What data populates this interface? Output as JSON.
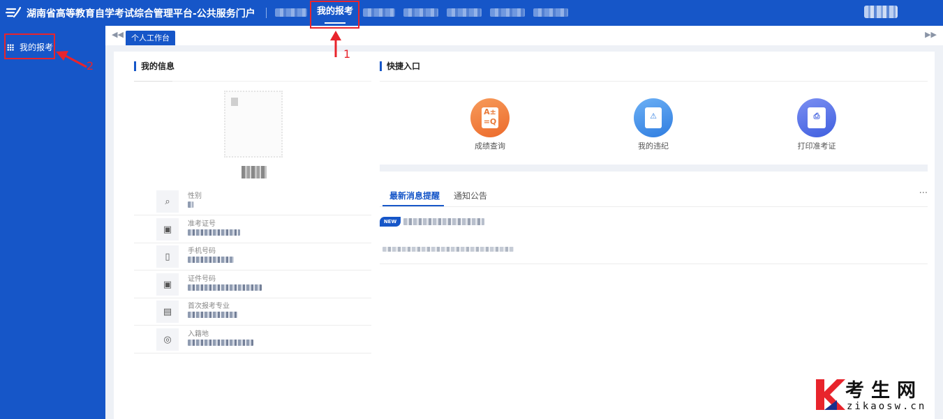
{
  "header": {
    "title": "湖南省高等教育自学考试综合管理平台-公共服务门户",
    "nav_active": "我的报考"
  },
  "sidebar": {
    "items": [
      {
        "label": "我的报考",
        "icon": "grid-icon"
      }
    ]
  },
  "tabs": {
    "items": [
      {
        "label": "个人工作台"
      }
    ]
  },
  "my_info": {
    "title": "我的信息",
    "fields": [
      {
        "label": "性别",
        "icon": "gender-icon"
      },
      {
        "label": "准考证号",
        "icon": "id-card-icon"
      },
      {
        "label": "手机号码",
        "icon": "phone-icon"
      },
      {
        "label": "证件号码",
        "icon": "id-card-icon"
      },
      {
        "label": "首次报考专业",
        "icon": "book-icon"
      },
      {
        "label": "入籍地",
        "icon": "location-icon"
      }
    ]
  },
  "quick_access": {
    "title": "快捷入口",
    "items": [
      {
        "label": "成绩查询",
        "icon": "score-query-icon",
        "color": "#f07a3c"
      },
      {
        "label": "我的违纪",
        "icon": "warning-doc-icon",
        "color": "#3f8fe8"
      },
      {
        "label": "打印准考证",
        "icon": "printer-icon",
        "color": "#4f6fe6"
      }
    ]
  },
  "news": {
    "tabs": [
      "最新消息提醒",
      "通知公告"
    ],
    "more": "···",
    "badge": "NEW"
  },
  "annotations": [
    "1",
    "2"
  ],
  "watermark": {
    "cn": "考生网",
    "en": "zikaosw.cn"
  },
  "colors": {
    "brand": "#1656c8",
    "annotation": "#e8242c"
  }
}
